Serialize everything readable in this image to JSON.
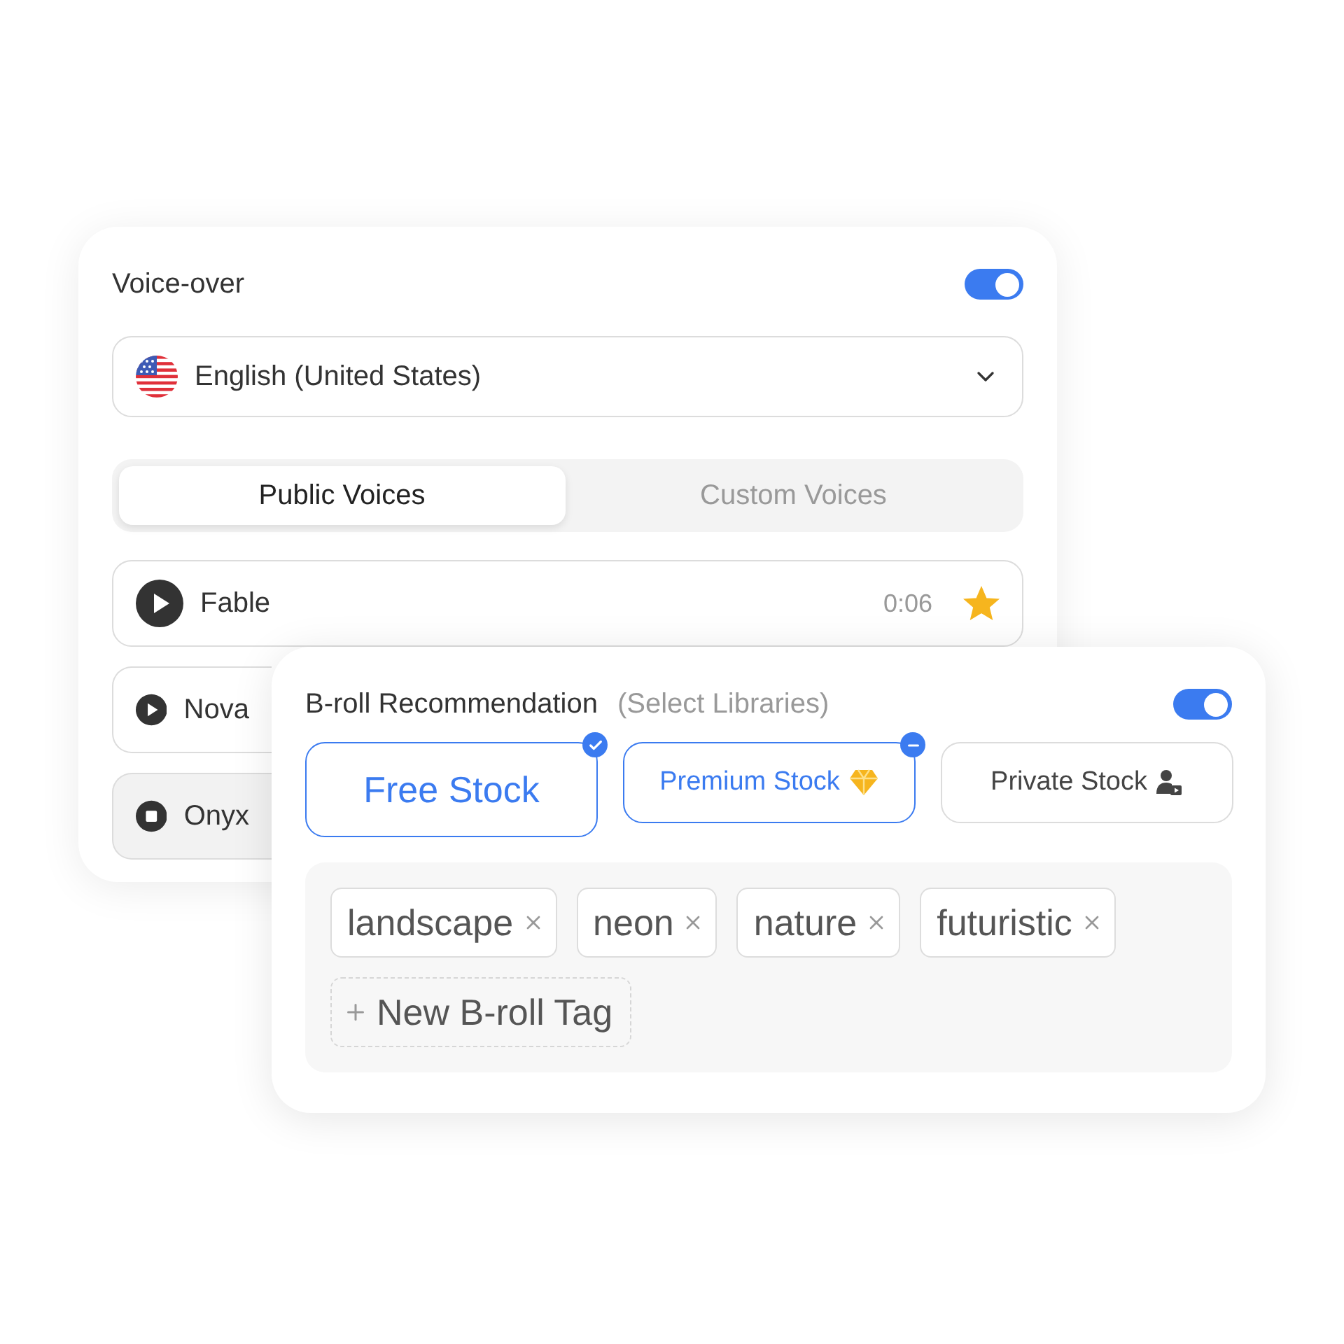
{
  "voice_over": {
    "title": "Voice-over",
    "on": true,
    "language": {
      "value": "English (United States)"
    },
    "tabs": [
      {
        "label": "Public Voices",
        "selected": true
      },
      {
        "label": "Custom Voices",
        "selected": false
      }
    ],
    "voices": [
      {
        "name": "Fable",
        "playing": false,
        "duration": "0:06",
        "favorite": true
      },
      {
        "name": "Nova",
        "playing": false
      },
      {
        "name": "Onyx",
        "playing": true
      }
    ]
  },
  "broll": {
    "title": "B-roll Recommendation",
    "subtitle": "(Select Libraries)",
    "on": true,
    "libraries": [
      {
        "label": "Free Stock",
        "checked": true,
        "partial": false,
        "kind": "plain"
      },
      {
        "label": "Premium Stock",
        "checked": false,
        "partial": true,
        "kind": "premium"
      },
      {
        "label": "Private Stock",
        "checked": false,
        "partial": false,
        "kind": "private"
      }
    ],
    "tags": [
      "landscape",
      "neon",
      "nature",
      "futuristic"
    ],
    "new_tag": "New B-roll Tag"
  }
}
